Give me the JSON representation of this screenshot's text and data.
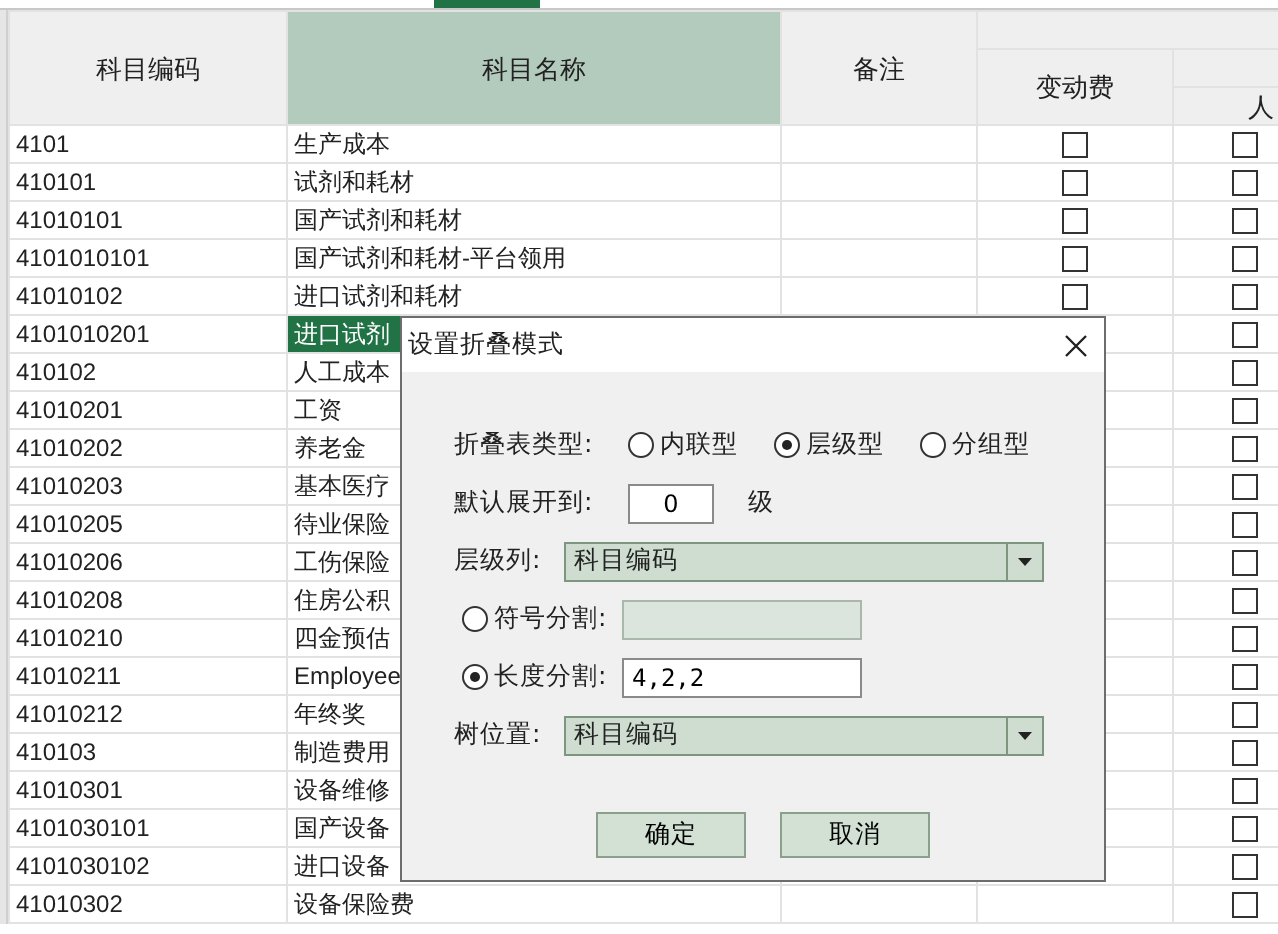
{
  "sheet": {
    "columns": [
      {
        "label": "科目编码",
        "selected": false
      },
      {
        "label": "科目名称",
        "selected": true
      },
      {
        "label": "备注",
        "selected": false
      },
      {
        "label": "变动费",
        "selected": false
      },
      {
        "label": "人",
        "selected": false
      }
    ],
    "rows": [
      {
        "code": "4101",
        "name": "生产成本",
        "selected": false,
        "variable_cost_checked": false,
        "column_5_checked": false
      },
      {
        "code": "410101",
        "name": "试剂和耗材",
        "selected": false,
        "variable_cost_checked": false,
        "column_5_checked": false
      },
      {
        "code": "41010101",
        "name": "国产试剂和耗材",
        "selected": false,
        "variable_cost_checked": false,
        "column_5_checked": false
      },
      {
        "code": "4101010101",
        "name": "国产试剂和耗材-平台领用",
        "selected": false,
        "variable_cost_checked": false,
        "column_5_checked": false
      },
      {
        "code": "41010102",
        "name": "进口试剂和耗材",
        "selected": false,
        "variable_cost_checked": false,
        "column_5_checked": false
      },
      {
        "code": "4101010201",
        "name": "进口试剂",
        "selected": true,
        "column_5_checked": false
      },
      {
        "code": "410102",
        "name": "人工成本",
        "selected": false,
        "column_5_checked": false
      },
      {
        "code": "41010201",
        "name": "工资",
        "selected": false,
        "column_5_checked": false
      },
      {
        "code": "41010202",
        "name": "养老金",
        "selected": false,
        "column_5_checked": false
      },
      {
        "code": "41010203",
        "name": "基本医疗",
        "selected": false,
        "column_5_checked": false
      },
      {
        "code": "41010205",
        "name": "待业保险",
        "selected": false,
        "column_5_checked": false
      },
      {
        "code": "41010206",
        "name": "工伤保险",
        "selected": false,
        "column_5_checked": false
      },
      {
        "code": "41010208",
        "name": "住房公积",
        "selected": false,
        "column_5_checked": false
      },
      {
        "code": "41010210",
        "name": "四金预估",
        "selected": false,
        "column_5_checked": false
      },
      {
        "code": "41010211",
        "name": "Employee",
        "selected": false,
        "column_5_checked": false
      },
      {
        "code": "41010212",
        "name": "年终奖",
        "selected": false,
        "column_5_checked": false
      },
      {
        "code": "410103",
        "name": "制造费用",
        "selected": false,
        "column_5_checked": false
      },
      {
        "code": "41010301",
        "name": "设备维修",
        "selected": false,
        "column_5_checked": false
      },
      {
        "code": "4101030101",
        "name": "国产设备",
        "selected": false,
        "column_5_checked": false
      },
      {
        "code": "4101030102",
        "name": "进口设备",
        "selected": false,
        "column_5_checked": false
      },
      {
        "code": "41010302",
        "name": "设备保险费",
        "selected": false,
        "column_5_checked": false
      }
    ]
  },
  "dialog": {
    "title": "设置折叠模式",
    "fold_type": {
      "label": "折叠表类型:",
      "options": [
        {
          "label": "内联型",
          "selected": false
        },
        {
          "label": "层级型",
          "selected": true
        },
        {
          "label": "分组型",
          "selected": false
        }
      ]
    },
    "expand_level": {
      "label": "默认展开到:",
      "value": "0",
      "unit": "级"
    },
    "level_column": {
      "label": "层级列:",
      "value": "科目编码"
    },
    "split_options": [
      {
        "label": "符号分割:",
        "selected": false,
        "disabled": true
      },
      {
        "label": "长度分割:",
        "selected": true,
        "disabled": false,
        "value": "4,2,2"
      }
    ],
    "tree_position": {
      "label": "树位置:",
      "value": "科目编码"
    },
    "buttons": [
      "确定",
      "取消"
    ]
  }
}
